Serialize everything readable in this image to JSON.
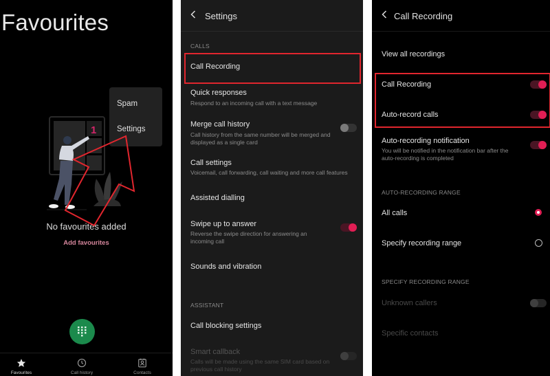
{
  "favourites_screen": {
    "title": "Favourites",
    "overflow_menu": {
      "items": [
        "Spam",
        "Settings"
      ]
    },
    "illustration_badge": "1",
    "empty_message": "No favourites added",
    "add_link": "Add favourites",
    "dialpad_button": "dialpad-icon",
    "bottom_nav": [
      {
        "label": "Favourites",
        "icon": "star-icon",
        "active": true
      },
      {
        "label": "Call history",
        "icon": "clock-icon",
        "active": false
      },
      {
        "label": "Contacts",
        "icon": "contact-card-icon",
        "active": false
      }
    ]
  },
  "settings_screen": {
    "title": "Settings",
    "section_calls": "CALLS",
    "items": [
      {
        "title": "Call Recording",
        "highlighted": true
      },
      {
        "title": "Quick responses",
        "subtitle": "Respond to an incoming call with a text message"
      },
      {
        "title": "Merge call history",
        "subtitle": "Call history from the same number will be merged and displayed as a single card",
        "toggle": false
      },
      {
        "title": "Call settings",
        "subtitle": "Voicemail, call forwarding, call waiting and more call features"
      },
      {
        "title": "Assisted dialling"
      },
      {
        "title": "Swipe up to answer",
        "subtitle": "Reverse the swipe direction for answering an incoming call",
        "toggle": true
      },
      {
        "title": "Sounds and vibration"
      }
    ],
    "section_assistant": "ASSISTANT",
    "assistant_items": [
      {
        "title": "Call blocking settings"
      },
      {
        "title": "Smart callback",
        "subtitle": "Calls will be made using the same SIM card based on previous call history",
        "toggle": false,
        "disabled": true
      }
    ]
  },
  "call_recording_screen": {
    "title": "Call Recording",
    "view_all": "View all recordings",
    "items": [
      {
        "title": "Call Recording",
        "toggle": true,
        "highlighted": true
      },
      {
        "title": "Auto-record calls",
        "toggle": true,
        "highlighted": true
      },
      {
        "title": "Auto-recording notification",
        "subtitle": "You will be notified in the notification bar after the auto-recording is completed",
        "toggle": true
      }
    ],
    "section_range": "AUTO-RECORDING RANGE",
    "range_options": [
      {
        "label": "All calls",
        "selected": true
      },
      {
        "label": "Specify recording range",
        "selected": false
      }
    ],
    "section_specify": "SPECIFY RECORDING RANGE",
    "specify_items": [
      {
        "title": "Unknown callers",
        "toggle": false,
        "disabled": true
      },
      {
        "title": "Specific contacts",
        "disabled": true
      }
    ]
  },
  "colors": {
    "accent": "#e11e54",
    "annotation_red": "#e2262e",
    "fab_green": "#1b8a4c",
    "link_pink": "#d5869c"
  }
}
